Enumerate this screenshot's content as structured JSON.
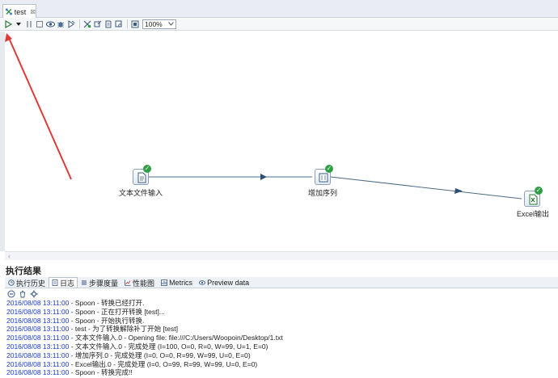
{
  "editor_tab": {
    "label": "test",
    "close_glyph": "⊠"
  },
  "toolbar": {
    "icons": [
      "run-icon",
      "run-dropdown-icon",
      "pause-icon",
      "stop-icon",
      "preview-icon",
      "debug-icon",
      "replay-icon",
      "verify-icon",
      "impact-icon",
      "sql-icon",
      "explore-db-icon",
      "show-results-icon"
    ],
    "zoom_value": "100%"
  },
  "canvas": {
    "steps": [
      {
        "label": "文本文件输入",
        "type": "text-file-input"
      },
      {
        "label": "增加序列",
        "type": "add-sequence"
      },
      {
        "label": "Excel输出",
        "type": "excel-output"
      }
    ],
    "colors": {
      "hop": "#4d6b86",
      "annotation_arrow": "#e03a3a",
      "check": "#2ea043"
    }
  },
  "results": {
    "title": "执行结果",
    "tabs": [
      {
        "label": "执行历史",
        "icon": "history-icon"
      },
      {
        "label": "日志",
        "icon": "log-icon",
        "active": true
      },
      {
        "label": "步骤度量",
        "icon": "step-metrics-icon"
      },
      {
        "label": "性能图",
        "icon": "performance-graph-icon"
      },
      {
        "label": "Metrics",
        "icon": "metrics-icon"
      },
      {
        "label": "Preview data",
        "icon": "preview-data-icon"
      }
    ],
    "log_toolbar": [
      "stop-log-icon",
      "clear-log-icon",
      "log-settings-icon"
    ],
    "log_lines": [
      {
        "ts": "2016/08/08 13:11:00",
        "msg": " - Spoon - 转换已经打开."
      },
      {
        "ts": "2016/08/08 13:11:00",
        "msg": " - Spoon - 正在打开转换 [test]..."
      },
      {
        "ts": "2016/08/08 13:11:00",
        "msg": " - Spoon - 开始执行转换."
      },
      {
        "ts": "2016/08/08 13:11:00",
        "msg": " - test - 为了转换解除补丁开始  [test]"
      },
      {
        "ts": "2016/08/08 13:11:00",
        "msg": " - 文本文件输入.0 - Opening file: file:///C:/Users/Woopoin/Desktop/1.txt"
      },
      {
        "ts": "2016/08/08 13:11:00",
        "msg": " - 文本文件输入.0 - 完成处理 (I=100, O=0, R=0, W=99, U=1, E=0)"
      },
      {
        "ts": "2016/08/08 13:11:00",
        "msg": " - 增加序列.0 - 完成处理 (I=0, O=0, R=99, W=99, U=0, E=0)"
      },
      {
        "ts": "2016/08/08 13:11:00",
        "msg": " - Excel输出.0 - 完成处理 (I=0, O=99, R=99, W=99, U=0, E=0)"
      },
      {
        "ts": "2016/08/08 13:11:00",
        "msg": " - Spoon - 转换完成!!"
      }
    ]
  }
}
